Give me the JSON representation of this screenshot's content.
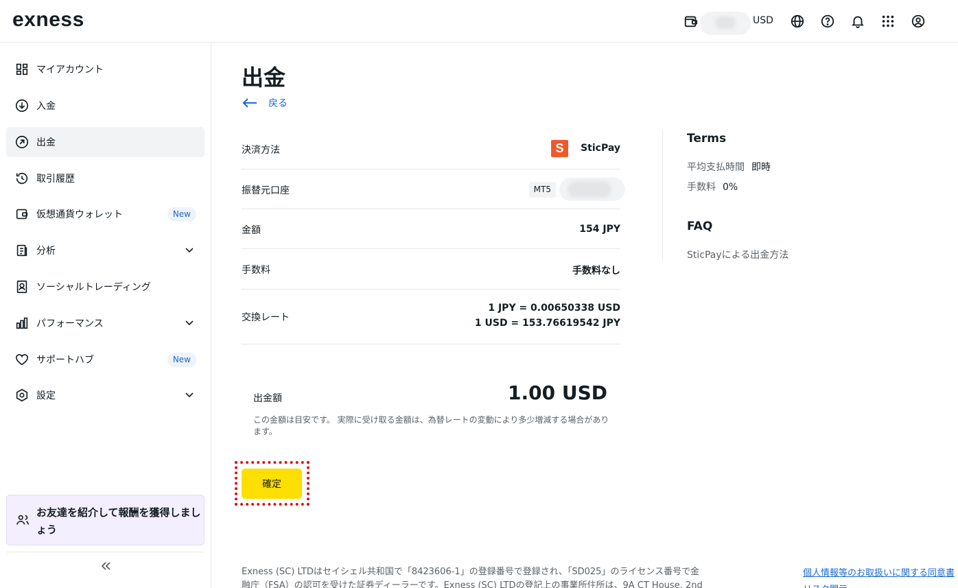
{
  "header": {
    "logo": "exness",
    "currency": "USD"
  },
  "sidebar": {
    "items": [
      {
        "label": "マイアカウント"
      },
      {
        "label": "入金"
      },
      {
        "label": "出金"
      },
      {
        "label": "取引履歴"
      },
      {
        "label": "仮想通貨ウォレット",
        "badge": "New"
      },
      {
        "label": "分析"
      },
      {
        "label": "ソーシャルトレーディング"
      },
      {
        "label": "パフォーマンス"
      },
      {
        "label": "サポートハブ",
        "badge": "New"
      },
      {
        "label": "設定"
      }
    ],
    "promo": "お友達を紹介して報酬を獲得しましょう"
  },
  "main": {
    "title": "出金",
    "back": "戻る",
    "rows": [
      {
        "label": "決済方法",
        "value": "SticPay"
      },
      {
        "label": "振替元口座",
        "value": "MT5"
      },
      {
        "label": "金額",
        "value": "154 JPY"
      },
      {
        "label": "手数料",
        "value": "手数料なし"
      },
      {
        "label": "交換レート",
        "value": "1 JPY = 0.00650338 USD",
        "value2": "1 USD = 153.76619542 JPY"
      }
    ],
    "total_label": "出金額",
    "total_value": "1.00 USD",
    "total_note": "この金額は目安です。 実際に受け取る金額は、為替レートの変動により多少増減する場合があります。",
    "confirm": "確定"
  },
  "terms": {
    "title": "Terms",
    "avg_time_label": "平均支払時間",
    "avg_time_value": "即時",
    "fee_label": "手数料",
    "fee_value": "0%",
    "faq_title": "FAQ",
    "faq_link": "SticPayによる出金方法"
  },
  "footer": {
    "text": "Exness (SC) LTDはセイシェル共和国で「8423606-1」の登録番号で登録され、「SD025」のライセンス番号で金融庁（FSA）の認可を受けた証券ディーラーです。Exness (SC) LTDの登記上の事業所住所は、9A CT House, 2nd",
    "link1": "個人情報等のお取扱いに関する同意書",
    "link2": "リスク開示"
  },
  "colors": {
    "accent": "#ffde02",
    "link": "#1a6ad1",
    "sticpay": "#ef5a2a",
    "annotation": "#e01010"
  }
}
